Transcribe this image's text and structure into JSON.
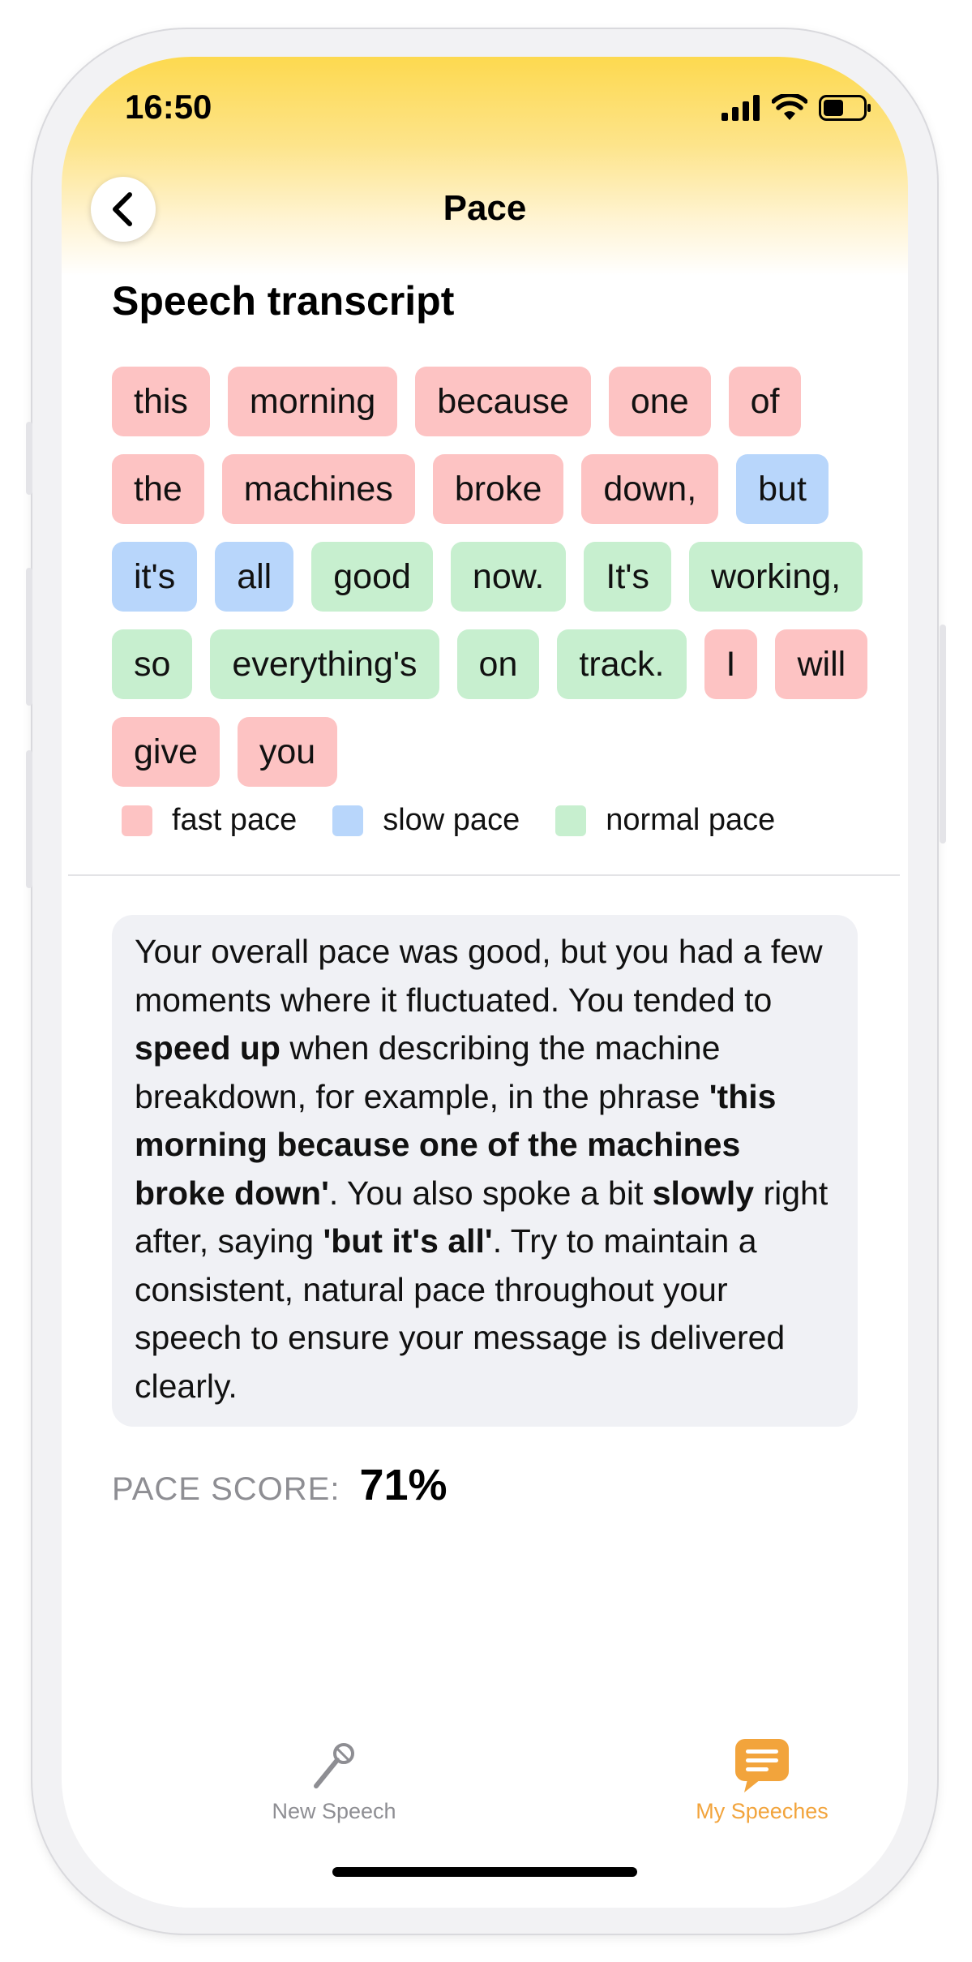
{
  "status_bar": {
    "time": "16:50"
  },
  "nav": {
    "title": "Pace"
  },
  "transcript": {
    "title": "Speech transcript",
    "words": [
      {
        "text": "this",
        "pace": "fast"
      },
      {
        "text": "morning",
        "pace": "fast"
      },
      {
        "text": "because",
        "pace": "fast"
      },
      {
        "text": "one",
        "pace": "fast"
      },
      {
        "text": "of",
        "pace": "fast"
      },
      {
        "text": "the",
        "pace": "fast"
      },
      {
        "text": "machines",
        "pace": "fast"
      },
      {
        "text": "broke",
        "pace": "fast"
      },
      {
        "text": "down,",
        "pace": "fast"
      },
      {
        "text": "but",
        "pace": "slow"
      },
      {
        "text": "it's",
        "pace": "slow"
      },
      {
        "text": "all",
        "pace": "slow"
      },
      {
        "text": "good",
        "pace": "normal"
      },
      {
        "text": "now.",
        "pace": "normal"
      },
      {
        "text": "It's",
        "pace": "normal"
      },
      {
        "text": "working,",
        "pace": "normal"
      },
      {
        "text": "so",
        "pace": "normal"
      },
      {
        "text": "everything's",
        "pace": "normal"
      },
      {
        "text": "on",
        "pace": "normal"
      },
      {
        "text": "track.",
        "pace": "normal"
      },
      {
        "text": "I",
        "pace": "fast"
      },
      {
        "text": "will",
        "pace": "fast"
      },
      {
        "text": "give",
        "pace": "fast"
      },
      {
        "text": "you",
        "pace": "fast"
      }
    ]
  },
  "legend": {
    "fast": "fast pace",
    "slow": "slow pace",
    "normal": "normal pace"
  },
  "colors": {
    "fast": "#fdc3c3",
    "slow": "#b8d6fb",
    "normal": "#c7efcf",
    "accent": "#f2a43c",
    "header_yellow": "#fdd94f"
  },
  "feedback": {
    "segments": [
      {
        "text": "Your overall pace was good, but you had a few moments where it fluctuated. You tended to ",
        "bold": false
      },
      {
        "text": "speed up",
        "bold": true
      },
      {
        "text": " when describing the machine breakdown, for example, in the phrase ",
        "bold": false
      },
      {
        "text": "'this morning because one of the machines broke down'",
        "bold": true
      },
      {
        "text": ". You also spoke a bit ",
        "bold": false
      },
      {
        "text": "slowly",
        "bold": true
      },
      {
        "text": " right after, saying ",
        "bold": false
      },
      {
        "text": "'but it's all'",
        "bold": true
      },
      {
        "text": ". Try to maintain a consistent, natural pace throughout your speech to ensure your message is delivered clearly.",
        "bold": false
      }
    ]
  },
  "score": {
    "label": "PACE SCORE:",
    "value": "71%"
  },
  "tabbar": {
    "new_speech": "New Speech",
    "my_speeches": "My Speeches",
    "active": "my_speeches",
    "new_speech_icon": "microphone-icon",
    "my_speeches_icon": "speech-bubble-icon"
  }
}
